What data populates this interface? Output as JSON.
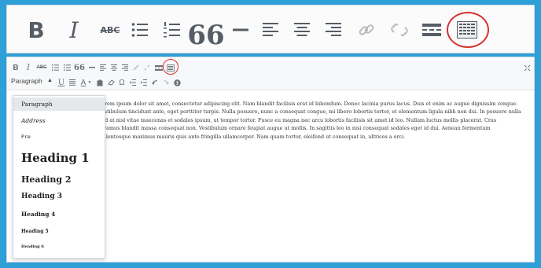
{
  "zoom_toolbar": {
    "buttons": [
      {
        "name": "bold",
        "label": "B"
      },
      {
        "name": "italic",
        "label": "I"
      },
      {
        "name": "strikethrough",
        "label": "ABC"
      },
      {
        "name": "bulleted-list",
        "icon": "bullet-list-icon"
      },
      {
        "name": "numbered-list",
        "icon": "numbered-list-icon"
      },
      {
        "name": "blockquote",
        "label": "66"
      },
      {
        "name": "horizontal-line",
        "icon": "horizontal-line-icon"
      },
      {
        "name": "align-left",
        "icon": "align-left-icon"
      },
      {
        "name": "align-center",
        "icon": "align-center-icon"
      },
      {
        "name": "align-right",
        "icon": "align-right-icon"
      },
      {
        "name": "insert-link",
        "icon": "link-icon"
      },
      {
        "name": "remove-link",
        "icon": "unlink-icon"
      },
      {
        "name": "read-more",
        "icon": "read-more-icon"
      },
      {
        "name": "toolbar-toggle",
        "icon": "kitchen-sink-icon",
        "highlighted": true
      }
    ]
  },
  "editor": {
    "toolbar1": {
      "bold": "B",
      "italic": "I",
      "strike": "ABC",
      "quote": "66"
    },
    "toolbar2": {
      "format_select": "Paragraph",
      "underline": "U",
      "text_color": "A",
      "special_chars": "Ω"
    },
    "content_lines": [
      "Lorem ipsum dolor sit amet, consectetur adipiscing elit. Nam blandit facilisis erat id bibendum. Donec lacinia purus lacus. Duis et enim ac augue dignissim congue.",
      "Vestibulum tincidunt ante, eget porttitor turpis. Nulla posuere, nunc a consequat congue, mi libero lobortis tortor, et elementum ligula nibh non dui. In posuere nulla",
      "Sed at nisl vitae maecenas et sodales ipsum, ut tempor tortor. Fusce eu magna nec arcu lobortis facilisis sit amet id leo. Nullam luctus mollis placerat. Cras",
      "Vivamus blandit massa consequat non. Vestibulum ornare feugiat augue ut mollis. In sagittis leo in nisi consequat sodales eget id dui. Aenean fermentum",
      "Pellentesque maximus mauris quis ante fringilla ullamcorper. Nam quam tortor, eleifend ut consequat in, ultrices a orci."
    ],
    "format_dropdown": {
      "items": [
        {
          "label": "Paragraph",
          "selected": true
        },
        {
          "label": "Address"
        },
        {
          "label": "Pre"
        },
        {
          "label": "Heading 1"
        },
        {
          "label": "Heading 2"
        },
        {
          "label": "Heading 3"
        },
        {
          "label": "Heading 4"
        },
        {
          "label": "Heading 5"
        },
        {
          "label": "Heading 6"
        }
      ]
    }
  },
  "colors": {
    "background": "#2f9fd8",
    "highlight_ring": "#d9302c",
    "icon_gray": "#555d66"
  }
}
